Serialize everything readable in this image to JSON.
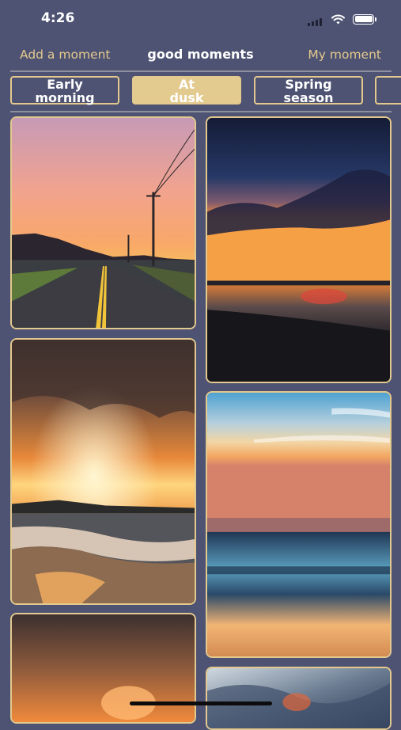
{
  "status_bar": {
    "time": "4:26",
    "icons": [
      "signal-icon",
      "wifi-icon",
      "battery-icon"
    ]
  },
  "nav": {
    "left_label": "Add a moment",
    "title": "good moments",
    "right_label": "My moment"
  },
  "tabs": [
    {
      "line1": "Early",
      "line2": "morning",
      "selected": false
    },
    {
      "line1": "At",
      "line2": "dusk",
      "selected": true
    },
    {
      "line1": "Spring",
      "line2": "season",
      "selected": false
    },
    {
      "line1": "",
      "line2": "",
      "selected": false
    }
  ],
  "colors": {
    "background": "#4e5373",
    "accent": "#e3c98d",
    "selected_tab": "#e3cb8f",
    "divider": "#8d8f9f"
  },
  "gallery": {
    "left_column": [
      "road-sunset-photo",
      "beach-clouds-sunset-photo",
      "orange-sky-photo"
    ],
    "right_column": [
      "ocean-dusk-photo",
      "long-exposure-sea-photo",
      "wave-splash-photo"
    ]
  }
}
